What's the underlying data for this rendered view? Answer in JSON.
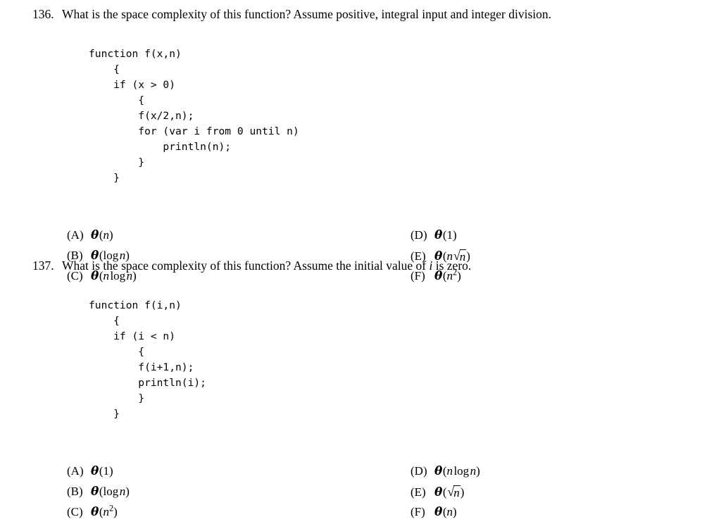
{
  "document": {
    "background_color": "#ffffff",
    "text_color": "#000000"
  },
  "questions": [
    {
      "number": "136.",
      "prompt_part1": "What is the space complexity of this function?  Assume positive, integral input and integer division.",
      "code": [
        "function f(x,n)",
        "    {",
        "    if (x > 0)",
        "        {",
        "        f(x/2,n);",
        "        for (var i from 0 until n)",
        "            println(n);",
        "        }",
        "    }"
      ],
      "options": {
        "left": [
          {
            "label": "(A)",
            "value": "θ(n)"
          },
          {
            "label": "(B)",
            "value": "θ(log n)"
          },
          {
            "label": "(C)",
            "value": "θ(n log n)"
          }
        ],
        "right": [
          {
            "label": "(D)",
            "value": "θ(1)"
          },
          {
            "label": "(E)",
            "value": "θ(n√n)"
          },
          {
            "label": "(F)",
            "value": "θ(n²)"
          }
        ]
      }
    },
    {
      "number": "137.",
      "prompt_part1": "What is the space complexity of this function?  Assume the initial value of",
      "prompt_italic": "i",
      "prompt_part2": "is zero.",
      "code": [
        "function f(i,n)",
        "    {",
        "    if (i < n)",
        "        {",
        "        f(i+1,n);",
        "        println(i);",
        "        }",
        "    }"
      ],
      "options": {
        "left": [
          {
            "label": "(A)",
            "value": "θ(1)"
          },
          {
            "label": "(B)",
            "value": "θ(log n)"
          },
          {
            "label": "(C)",
            "value": "θ(n²)"
          }
        ],
        "right": [
          {
            "label": "(D)",
            "value": "θ(n log n)"
          },
          {
            "label": "(E)",
            "value": "θ(√n)"
          },
          {
            "label": "(F)",
            "value": "θ(n)"
          }
        ]
      }
    }
  ]
}
